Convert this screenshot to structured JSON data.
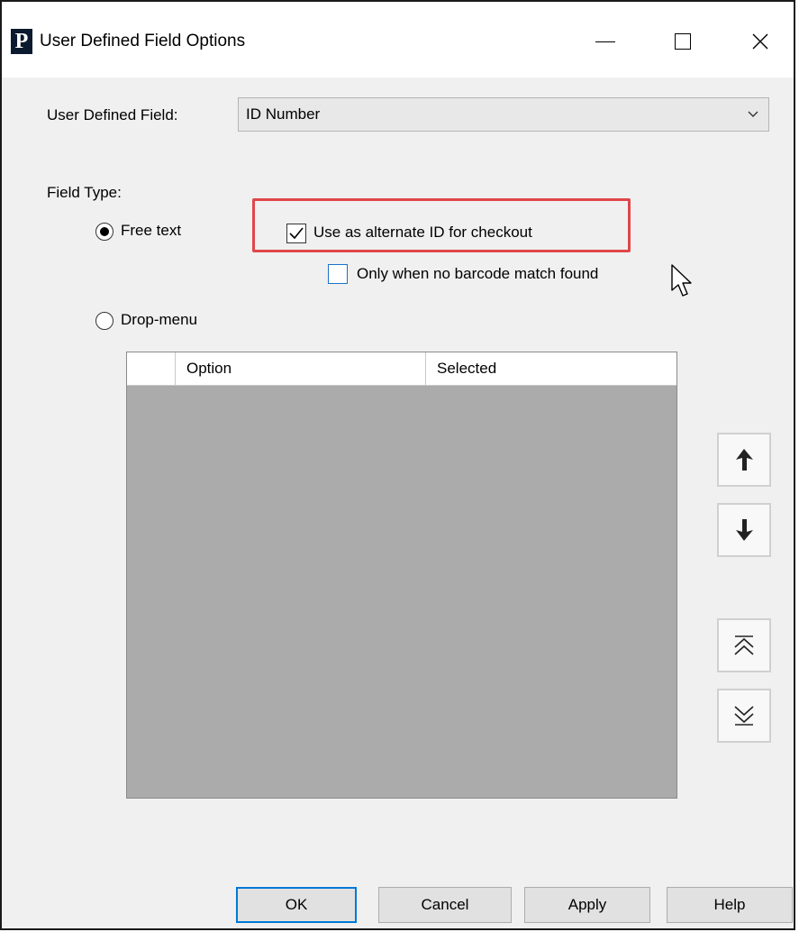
{
  "window": {
    "title": "User Defined Field Options",
    "app_icon_letter": "P"
  },
  "form": {
    "field_label": "User Defined Field:",
    "field_value": "ID Number",
    "field_type_label": "Field Type:",
    "free_text_label": "Free text",
    "free_text_selected": true,
    "alternate_id_label": "Use as alternate ID for checkout",
    "alternate_id_checked": true,
    "no_barcode_label": "Only when no barcode match found",
    "no_barcode_checked": false,
    "drop_menu_label": "Drop-menu",
    "drop_menu_selected": false
  },
  "grid": {
    "columns": [
      "",
      "Option",
      "Selected"
    ],
    "rows": []
  },
  "buttons": {
    "ok": "OK",
    "cancel": "Cancel",
    "apply": "Apply",
    "help": "Help"
  },
  "colors": {
    "highlight": "#e0464a",
    "primary_border": "#0078d7"
  }
}
